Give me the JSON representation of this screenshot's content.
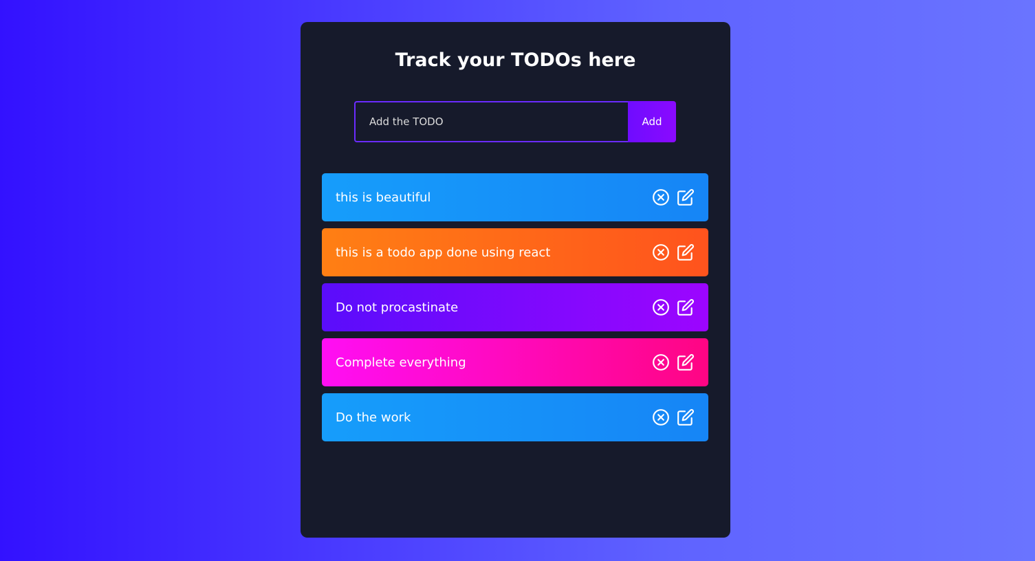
{
  "header": {
    "title": "Track your TODOs here"
  },
  "form": {
    "placeholder": "Add the TODO",
    "add_label": "Add"
  },
  "todos": [
    {
      "text": "this is beautiful",
      "color": "blue"
    },
    {
      "text": "this is a todo app done using react",
      "color": "orange"
    },
    {
      "text": "Do not procastinate",
      "color": "purple"
    },
    {
      "text": "Complete everything",
      "color": "pink"
    },
    {
      "text": "Do the work",
      "color": "blue"
    }
  ],
  "icons": {
    "delete": "close-circle-icon",
    "edit": "edit-icon"
  },
  "colors": {
    "background_start": "#3311ff",
    "background_end": "#6a74ff",
    "panel": "#161a2b",
    "accent": "#6b2bff",
    "todo_blue": "#169dfb",
    "todo_orange": "#ff7f14",
    "todo_purple": "#5a0dfb",
    "todo_pink": "#ff0ef4"
  }
}
